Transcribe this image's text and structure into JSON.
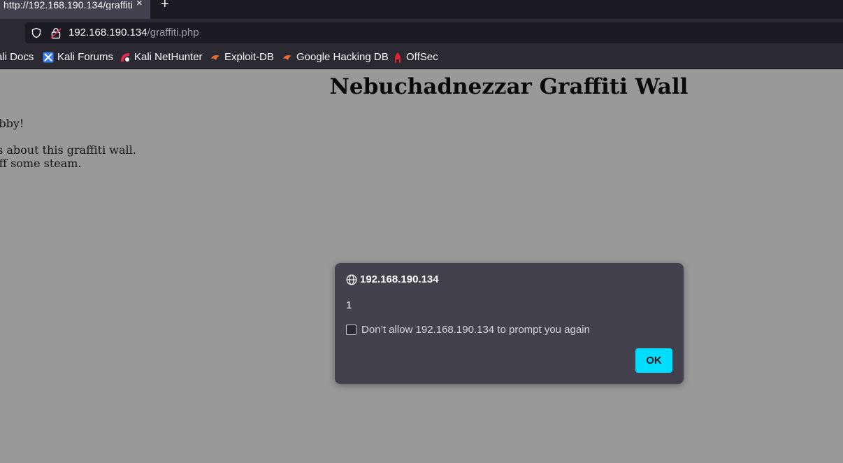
{
  "browser": {
    "tab": {
      "title": "http://192.168.190.134/graffiti",
      "close_glyph": "×"
    },
    "new_tab_glyph": "+",
    "url": {
      "host": "192.168.190.134",
      "path": "/graffiti.php"
    },
    "bookmarks": [
      {
        "label": "ali Docs",
        "icon": "kali-docs-icon"
      },
      {
        "label": "Kali Forums",
        "icon": "kali-forums-icon"
      },
      {
        "label": "Kali NetHunter",
        "icon": "kali-nethunter-icon"
      },
      {
        "label": "Exploit-DB",
        "icon": "exploit-db-icon"
      },
      {
        "label": "Google Hacking DB",
        "icon": "google-hacking-db-icon"
      },
      {
        "label": "OffSec",
        "icon": "offsec-icon"
      }
    ]
  },
  "page": {
    "title": "Nebuchadnezzar Graffiti Wall",
    "lines": [
      "ne Nebby!",
      "heus about this graffiti wall.",
      "off some steam."
    ]
  },
  "dialog": {
    "origin": "192.168.190.134",
    "message": "1",
    "checkbox_label": "Don’t allow 192.168.190.134 to prompt you again",
    "checkbox_checked": false,
    "ok_label": "OK"
  },
  "colors": {
    "accent": "#00ddff",
    "toolbar": "#2b2a33",
    "dialog_bg": "#42414d",
    "overlay": "#999999"
  }
}
